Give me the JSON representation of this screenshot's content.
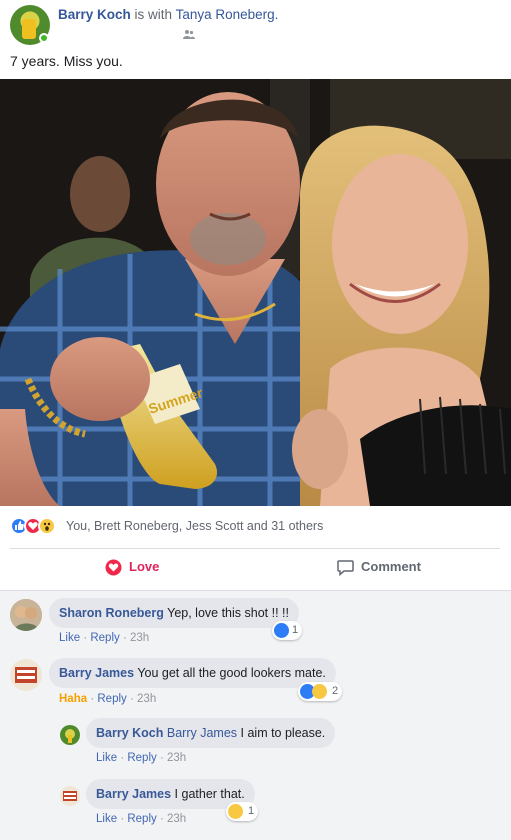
{
  "post": {
    "author": "Barry Koch",
    "with_text": "is with",
    "tagged": "Tanya Roneberg.",
    "text": "7 years. Miss you."
  },
  "reactions": {
    "summary": "You, Brett Roneberg, Jess Scott and 31 others",
    "icons": [
      "like-reaction-icon",
      "love-reaction-icon",
      "wow-reaction-icon"
    ]
  },
  "actions": {
    "love": "Love",
    "comment": "Comment"
  },
  "comments": [
    {
      "name": "Sharon Roneberg",
      "text": "Yep, love this shot !! !!",
      "reaction_label": "",
      "reply": "Reply",
      "like": "Like",
      "time": "23h",
      "reaction_count": "1",
      "sep": "·"
    },
    {
      "name": "Barry James",
      "text": "You get all the good lookers mate.",
      "reaction_label": "Haha",
      "reply": "Reply",
      "like": "",
      "time": "23h",
      "reaction_count": "2",
      "sep": "·"
    }
  ],
  "replies": [
    {
      "name": "Barry Koch",
      "mention": "Barry James",
      "text": "I aim to please.",
      "like": "Like",
      "reply": "Reply",
      "time": "23h",
      "sep": "·"
    },
    {
      "name": "Barry James",
      "mention": "",
      "text": "I gather that.",
      "like": "Like",
      "reply": "Reply",
      "time": "23h",
      "reaction_count": "1",
      "sep": "·"
    }
  ],
  "colors": {
    "link": "#365899",
    "love": "#e0245e",
    "like_blue": "#2e7cf6",
    "haha": "#f7a000"
  }
}
